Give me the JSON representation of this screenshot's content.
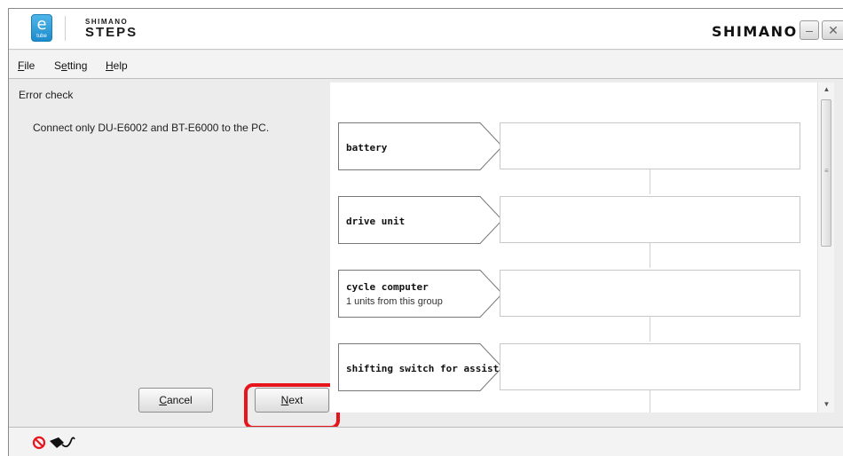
{
  "titlebar": {
    "etube_main": "e",
    "etube_sub": "tube",
    "product_small": "SHIMANO",
    "product_big": "STEPS",
    "brand": "SHIMANO",
    "minimize_glyph": "–",
    "close_glyph": "✕"
  },
  "menubar": {
    "file": {
      "accel": "F",
      "rest": "ile"
    },
    "setting": {
      "pre": "S",
      "accel": "e",
      "rest": "tting"
    },
    "help": {
      "accel": "H",
      "rest": "elp"
    }
  },
  "left": {
    "section_title": "Error check",
    "instruction": "Connect only DU-E6002 and BT-E6000 to the PC."
  },
  "buttons": {
    "cancel": {
      "accel": "C",
      "rest": "ancel"
    },
    "next": {
      "accel": "N",
      "rest": "ext"
    }
  },
  "components": [
    {
      "label": "battery",
      "sublabel": ""
    },
    {
      "label": "drive unit",
      "sublabel": ""
    },
    {
      "label": "cycle computer",
      "sublabel": "1 units from this group"
    },
    {
      "label": "shifting switch for assist",
      "sublabel": ""
    }
  ],
  "icons": {
    "status_no_connection": "no-connection-icon",
    "status_cable": "cable-icon",
    "highlight_color": "#e8141c"
  }
}
